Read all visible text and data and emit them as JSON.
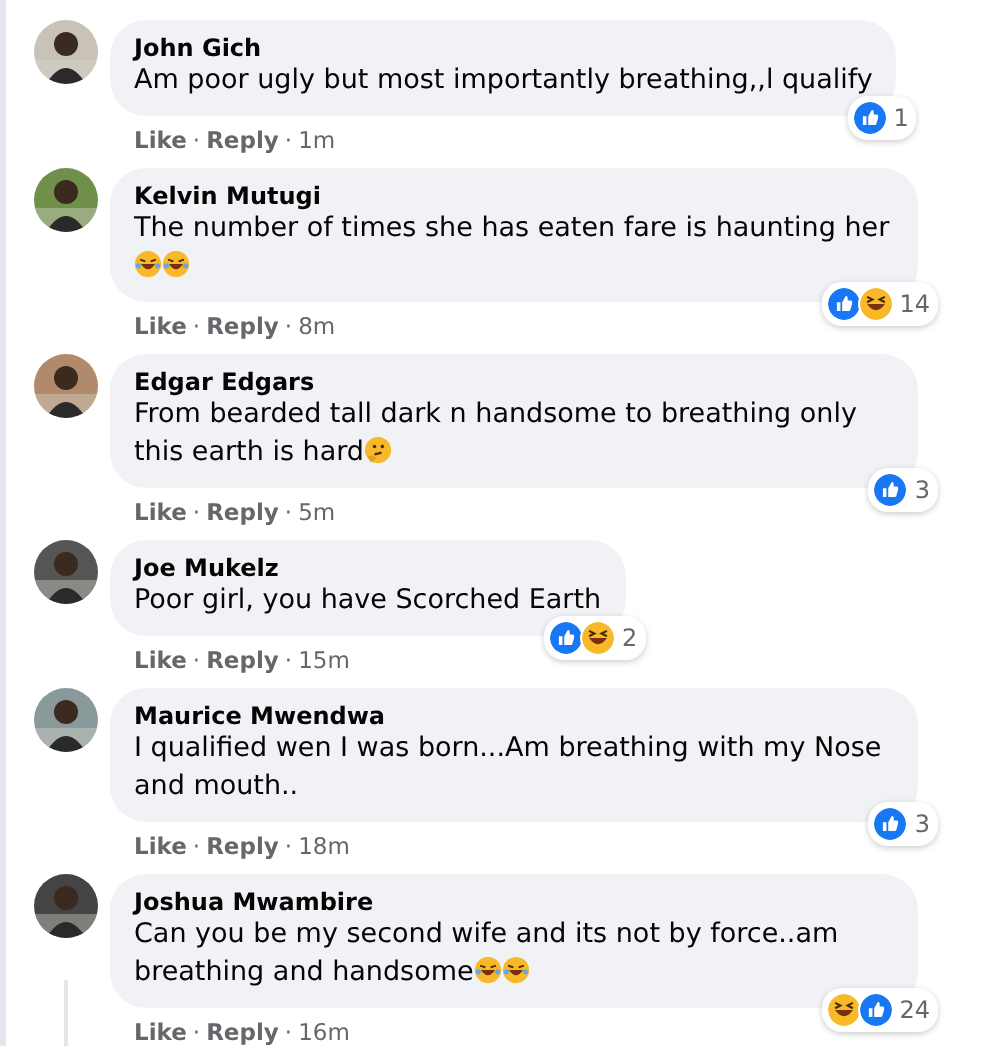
{
  "comments": [
    {
      "author": "John Gich",
      "text": "Am poor ugly but most importantly breathing,,l qualify",
      "reactions": [
        {
          "kind": "like"
        }
      ],
      "reaction_count": "1",
      "actions": [
        "Like",
        "Reply"
      ],
      "separators": [
        "·",
        "·"
      ],
      "time": "1m"
    },
    {
      "author": "Kelvin Mutugi",
      "text": "The number of times she has eaten fare is haunting her",
      "emojis": [
        {
          "kind": "rofl"
        },
        {
          "kind": "rofl"
        }
      ],
      "reactions": [
        {
          "kind": "like"
        },
        {
          "kind": "haha"
        }
      ],
      "reaction_count": "14",
      "actions": [
        "Like",
        "Reply"
      ],
      "separators": [
        "·",
        "·"
      ],
      "time": "8m"
    },
    {
      "author": "Edgar Edgars",
      "text": "From bearded tall dark n handsome to breathing only this earth is hard",
      "emojis": [
        {
          "kind": "thinking"
        }
      ],
      "reactions": [
        {
          "kind": "like"
        }
      ],
      "reaction_count": "3",
      "actions": [
        "Like",
        "Reply"
      ],
      "separators": [
        "·",
        "·"
      ],
      "time": "5m"
    },
    {
      "author": "Joe Mukelz",
      "text": "Poor girl, you have Scorched Earth",
      "reactions": [
        {
          "kind": "like"
        },
        {
          "kind": "haha"
        }
      ],
      "reaction_count": "2",
      "actions": [
        "Like",
        "Reply"
      ],
      "separators": [
        "·",
        "·"
      ],
      "time": "15m"
    },
    {
      "author": "Maurice Mwendwa",
      "text": "I qualified wen I was born...Am breathing with my Nose and mouth..",
      "reactions": [
        {
          "kind": "like"
        }
      ],
      "reaction_count": "3",
      "actions": [
        "Like",
        "Reply"
      ],
      "separators": [
        "·",
        "·"
      ],
      "time": "18m"
    },
    {
      "author": "Joshua Mwambire",
      "text": "Can you be my second wife and its not by force..am breathing and handsome",
      "emojis": [
        {
          "kind": "rofl"
        },
        {
          "kind": "rofl"
        }
      ],
      "reactions": [
        {
          "kind": "haha"
        },
        {
          "kind": "like"
        }
      ],
      "reaction_count": "24",
      "actions": [
        "Like",
        "Reply"
      ],
      "separators": [
        "·",
        "·"
      ],
      "time": "16m"
    }
  ]
}
